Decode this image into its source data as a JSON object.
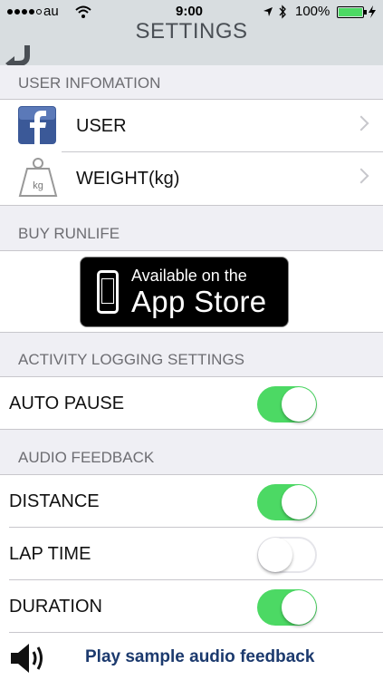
{
  "status_bar": {
    "carrier": "au",
    "time": "9:00",
    "battery": "100%"
  },
  "nav": {
    "title": "SETTINGS"
  },
  "user_info": {
    "header": "USER INFOMATION",
    "items": [
      {
        "label": "USER"
      },
      {
        "label": "WEIGHT(kg)"
      }
    ],
    "weight_icon_text": "kg"
  },
  "buy": {
    "header": "BUY RUNLIFE",
    "badge_line1": "Available on the",
    "badge_line2": "App Store"
  },
  "activity": {
    "header": "ACTIVITY LOGGING SETTINGS",
    "items": [
      {
        "label": "AUTO PAUSE",
        "on": true
      }
    ]
  },
  "audio": {
    "header": "AUDIO FEEDBACK",
    "items": [
      {
        "label": "DISTANCE",
        "on": true
      },
      {
        "label": "LAP TIME",
        "on": false
      },
      {
        "label": "DURATION",
        "on": true
      }
    ],
    "play_label": "Play sample audio feedback"
  },
  "colors": {
    "toggle_on": "#4cd964",
    "link": "#1c3a6e",
    "facebook": "#3b5998"
  }
}
